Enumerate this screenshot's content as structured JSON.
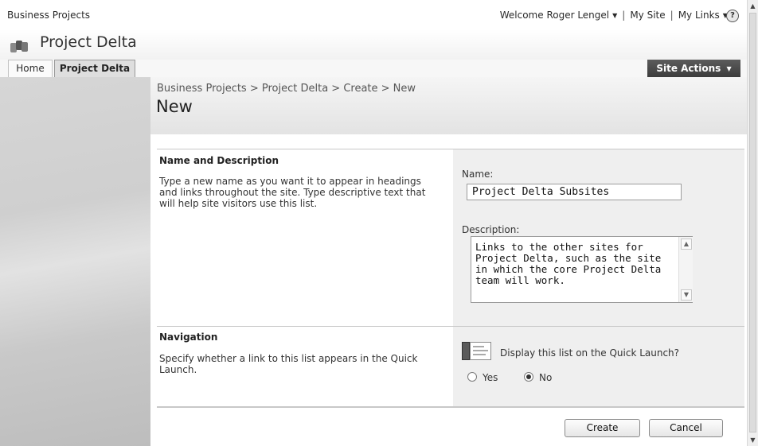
{
  "top_bar": {
    "site_name": "Business Projects",
    "welcome": "Welcome Roger Lengel",
    "my_site": "My Site",
    "my_links": "My Links",
    "separator": "|",
    "help_glyph": "?"
  },
  "site_title": "Project Delta",
  "nav": {
    "tabs": [
      {
        "label": "Home",
        "selected": false
      },
      {
        "label": "Project Delta",
        "selected": true
      }
    ],
    "site_actions": "Site Actions"
  },
  "breadcrumb": "Business Projects > Project Delta > Create > New",
  "page_title": "New",
  "sections": {
    "name_desc": {
      "heading": "Name and Description",
      "description": "Type a new name as you want it to appear in headings and links throughout the site. Type descriptive text that will help site visitors use this list.",
      "name_label": "Name:",
      "name_value": "Project Delta Subsites",
      "description_label": "Description:",
      "description_value": "Links to the other sites for Project Delta, such as the site in which the core Project Delta team will work."
    },
    "navigation": {
      "heading": "Navigation",
      "description": "Specify whether a link to this list appears in the Quick Launch.",
      "question": "Display this list on the Quick Launch?",
      "options": [
        {
          "label": "Yes",
          "selected": false
        },
        {
          "label": "No",
          "selected": true
        }
      ]
    }
  },
  "buttons": {
    "create": "Create",
    "cancel": "Cancel"
  },
  "icons": {
    "logo": "people-group-icon",
    "help": "help-icon",
    "quick_launch": "quick-launch-icon"
  }
}
